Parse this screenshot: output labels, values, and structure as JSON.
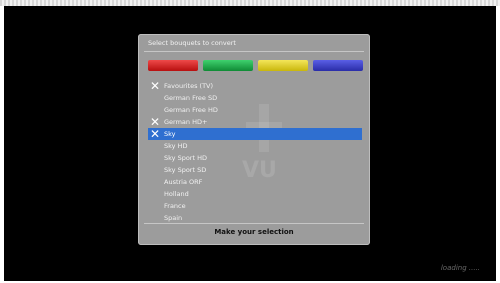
{
  "dialog": {
    "title": "Select bouquets to convert",
    "color_buttons": [
      {
        "name": "red",
        "color": "#d62222"
      },
      {
        "name": "green",
        "color": "#22a84a"
      },
      {
        "name": "yellow",
        "color": "#e0cf23"
      },
      {
        "name": "blue",
        "color": "#3b3fd0"
      }
    ],
    "items": [
      {
        "label": "Favourites (TV)",
        "checked": true,
        "selected": false
      },
      {
        "label": "German Free SD",
        "checked": false,
        "selected": false
      },
      {
        "label": "German Free HD",
        "checked": false,
        "selected": false
      },
      {
        "label": "German HD+",
        "checked": true,
        "selected": false
      },
      {
        "label": "Sky",
        "checked": true,
        "selected": true
      },
      {
        "label": "Sky HD",
        "checked": false,
        "selected": false
      },
      {
        "label": "Sky Sport HD",
        "checked": false,
        "selected": false
      },
      {
        "label": "Sky Sport SD",
        "checked": false,
        "selected": false
      },
      {
        "label": "Austria ORF",
        "checked": false,
        "selected": false
      },
      {
        "label": "Holland",
        "checked": false,
        "selected": false
      },
      {
        "label": "France",
        "checked": false,
        "selected": false
      },
      {
        "label": "Spain",
        "checked": false,
        "selected": false
      }
    ],
    "footer_text": "Make your selection",
    "checkmark_glyph": "✕"
  },
  "status": {
    "loading_text": "loading ....."
  },
  "watermark": {
    "text": "VU"
  }
}
